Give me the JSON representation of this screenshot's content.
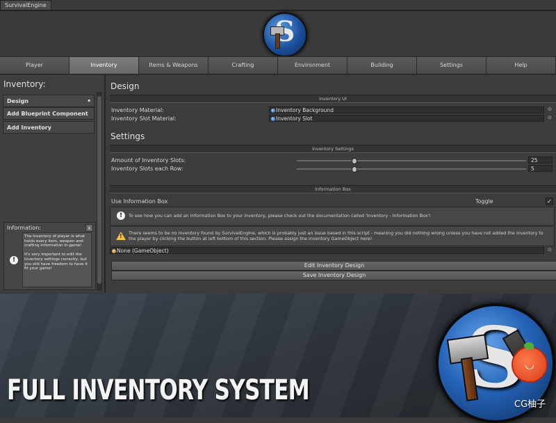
{
  "window": {
    "tab_title": "SurvivalEngine"
  },
  "nav": {
    "tabs": [
      "Player",
      "Inventory",
      "Items & Weapons",
      "Crafting",
      "Environment",
      "Building",
      "Settings",
      "Help"
    ],
    "active": "Inventory"
  },
  "sidebar": {
    "title": "Inventory:",
    "items": [
      {
        "label": "Design",
        "marker": "•"
      },
      {
        "label": "Add Blueprint Component"
      },
      {
        "label": "Add Inventory"
      }
    ],
    "info": {
      "title": "Information:",
      "close": "x",
      "text": "The inventory of player is what holds every item, weapon and crafting information in-game!\n\nIt's very important to edit the Inventory settings correctly, but you still have freedom to have it fit your game!"
    }
  },
  "main": {
    "design": {
      "heading": "Design",
      "group": "Inventory UI",
      "fields": [
        {
          "label": "Inventory Material:",
          "value": "Inventory Background"
        },
        {
          "label": "Inventory Slot Material:",
          "value": "Inventory Slot"
        }
      ]
    },
    "settings": {
      "heading": "Settings",
      "group": "Inventory Settings",
      "sliders": [
        {
          "label": "Amount of Inventory Slots:",
          "value": "25",
          "fraction": 0.25
        },
        {
          "label": "Inventory Slots each Row:",
          "value": "5",
          "fraction": 0.25
        }
      ]
    },
    "information_box": {
      "group": "Information Box",
      "use_label": "Use Information Box",
      "toggle_label": "Toggle",
      "toggle_checked": "✓",
      "info_message": "To see how you can add an Information Box to your inventory, please check out the documentation called 'Inventory - Information Box'!",
      "warning_message": "There seems to be no inventory found by SurvivalEngine, which is probably just an issue based in this script - meaning you did nothing wrong unless you have not added the inventory to the player by clicking the button at left bottom of this section. Please assign the inventory GameObject here!",
      "object_field": "None (GameObject)"
    },
    "buttons": {
      "edit": "Edit Inventory Design",
      "save": "Save Inventory Design"
    }
  },
  "banner": {
    "title": "FULL INVENTORY SYSTEM",
    "watermark": "CG柚子"
  },
  "colors": {
    "warning": "#f3c23a",
    "accent_blue": "#2563b8",
    "active_tab": "#727272"
  }
}
